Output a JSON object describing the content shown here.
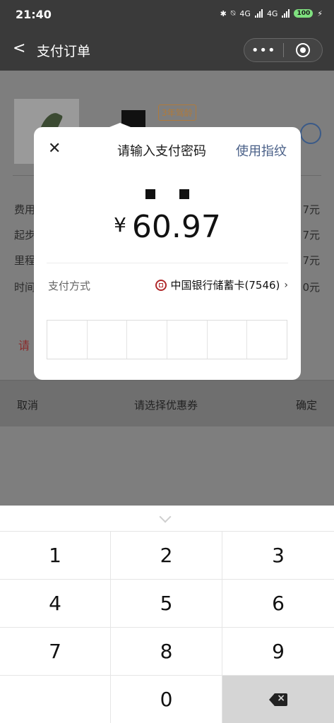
{
  "status_bar": {
    "time": "21:40",
    "battery": "100",
    "net1": "4G",
    "net2": "4G"
  },
  "nav": {
    "title": "支付订单",
    "more_icon": "more-dots-icon",
    "target_icon": "target-icon"
  },
  "background": {
    "tag": "3年驾龄",
    "rows": [
      {
        "label": "费用",
        "value": "7元"
      },
      {
        "label": "起步",
        "value": "7元"
      },
      {
        "label": "里程",
        "value": "7元"
      },
      {
        "label": "时间",
        "value": "0元"
      }
    ],
    "red_text": "请",
    "coupon_bar": {
      "cancel": "取消",
      "title": "请选择优惠券",
      "confirm": "确定"
    }
  },
  "dialog": {
    "title": "请输入支付密码",
    "fingerprint": "使用指纹",
    "currency": "¥",
    "amount": "60.97",
    "payment_method_label": "支付方式",
    "payment_method_value": "中国银行储蓄卡(7546)",
    "password_cells": 6
  },
  "keyboard": {
    "keys": [
      "1",
      "2",
      "3",
      "4",
      "5",
      "6",
      "7",
      "8",
      "9",
      "",
      "0",
      "delete"
    ]
  }
}
